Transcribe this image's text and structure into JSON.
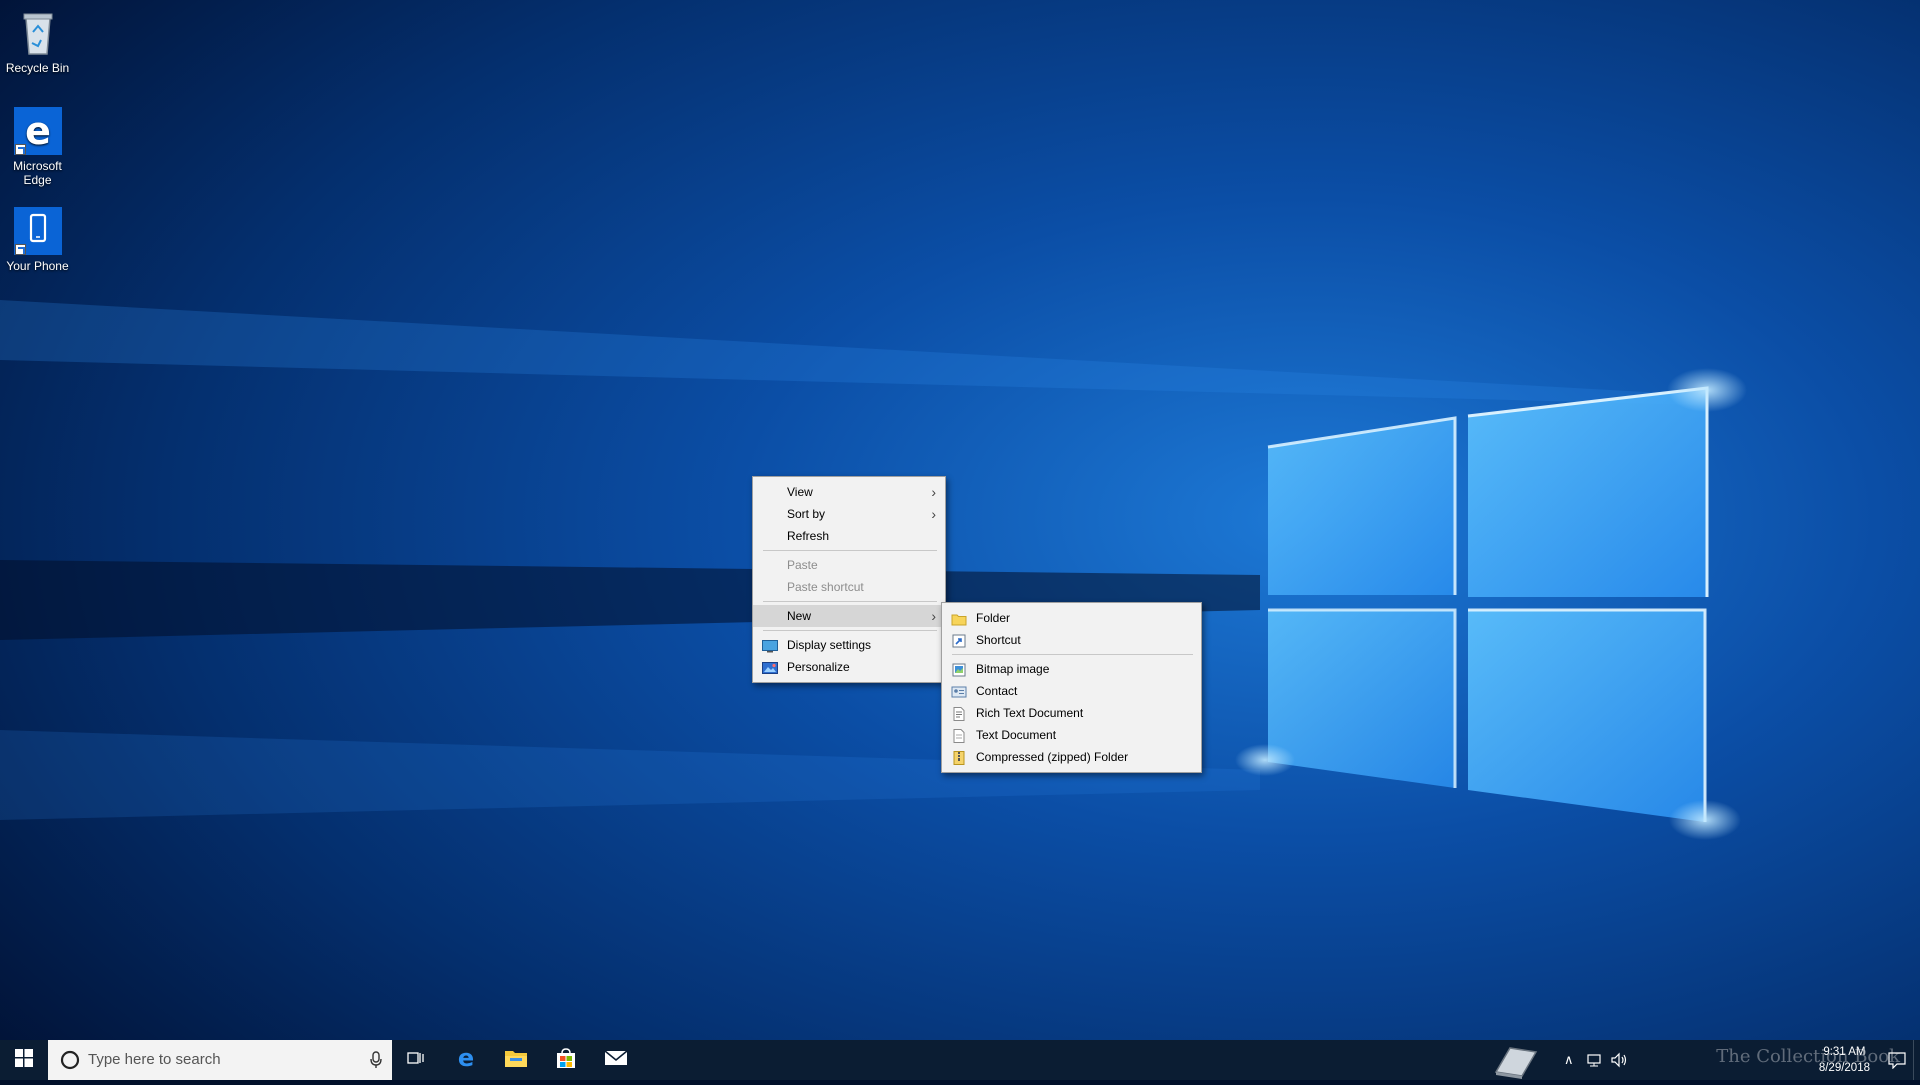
{
  "desktop": {
    "icons": [
      {
        "label": "Recycle Bin",
        "icon": "recycle-bin-icon"
      },
      {
        "label": "Microsoft Edge",
        "icon": "edge-icon"
      },
      {
        "label": "Your Phone",
        "icon": "phone-icon"
      }
    ]
  },
  "context_menu": {
    "items": [
      {
        "label": "View",
        "has_submenu": true
      },
      {
        "label": "Sort by",
        "has_submenu": true
      },
      {
        "label": "Refresh"
      },
      {
        "label": "Paste",
        "disabled": true
      },
      {
        "label": "Paste shortcut",
        "disabled": true
      },
      {
        "label": "New",
        "has_submenu": true,
        "highlighted": true
      },
      {
        "label": "Display settings",
        "icon": "display-settings-icon"
      },
      {
        "label": "Personalize",
        "icon": "personalize-icon"
      }
    ]
  },
  "new_submenu": {
    "items": [
      {
        "label": "Folder",
        "icon": "folder-icon"
      },
      {
        "label": "Shortcut",
        "icon": "shortcut-icon"
      },
      {
        "label": "Bitmap image",
        "icon": "bitmap-icon"
      },
      {
        "label": "Contact",
        "icon": "contact-icon"
      },
      {
        "label": "Rich Text Document",
        "icon": "rich-text-icon"
      },
      {
        "label": "Text Document",
        "icon": "text-document-icon"
      },
      {
        "label": "Compressed (zipped) Folder",
        "icon": "zip-folder-icon"
      }
    ]
  },
  "taskbar": {
    "search_placeholder": "Type here to search",
    "pinned": [
      "task-view-icon",
      "edge-icon",
      "file-explorer-icon",
      "store-icon",
      "mail-icon"
    ],
    "clock": {
      "time": "9:31 AM",
      "date": "8/29/2018"
    },
    "watermark": "The Collection Book"
  },
  "colors": {
    "accent": "#0a64d6",
    "taskbar": "#0b1d33",
    "menu_bg": "#f2f2f2",
    "menu_highlight": "#d6d6d6"
  }
}
